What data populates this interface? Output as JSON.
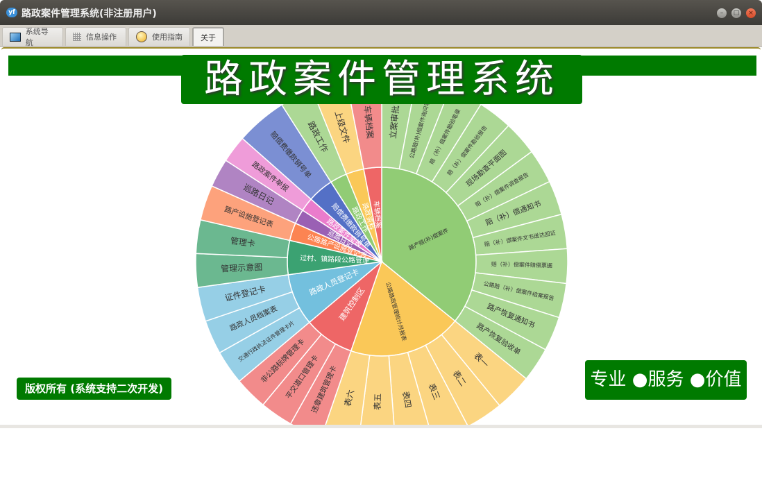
{
  "window": {
    "title": "路政案件管理系统(非注册用户)",
    "controls": [
      "minimize",
      "maximize",
      "close"
    ]
  },
  "tabs": [
    {
      "label": "系统导航",
      "icon": "monitor-icon"
    },
    {
      "label": "信息操作",
      "icon": "grid-icon"
    },
    {
      "label": "使用指南",
      "icon": "help-icon"
    },
    {
      "label": "关于",
      "active": true
    }
  ],
  "banner": {
    "title": "路政案件管理系统"
  },
  "footer": {
    "copyright": "版权所有 (系统支持二次开发)",
    "slogan": "专业 ●服务 ●价值"
  },
  "colors": {
    "brand_green": "#007a00"
  },
  "chart_data": {
    "type": "sunburst",
    "nodes": [
      {
        "name": "路产赔(补)偿案件",
        "span": [
          0,
          129
        ],
        "color": "#91cc75",
        "outer": "#acd895",
        "children": [
          "立案审批",
          "公路赔(补)偿案件询问笔录",
          "赔（补）偿案件勘验笔录",
          "赔（补）偿案件勘验报告",
          "现场勘查平面图",
          "赔（补）偿案件调查报告",
          "赔（补）偿通知书",
          "赔（补）偿案件文书送达回证",
          "赔（补）偿案件赔偿票据",
          "公路赔（补）偿案件结案报告",
          "路产恢复通知书",
          "路产恢复验收单"
        ]
      },
      {
        "name": "公路路政管理统计月报表",
        "span": [
          129,
          199
        ],
        "color": "#fac858",
        "outer": "#fbd581",
        "children": [
          "表一",
          "表二",
          "表三",
          "表四",
          "表五",
          "表六"
        ]
      },
      {
        "name": "建筑控制区",
        "span": [
          199,
          230
        ],
        "color": "#ee6666",
        "outer": "#f28b8b",
        "children": [
          "违章建筑管理卡",
          "平交道口管理卡",
          "非公路标牌管理卡"
        ]
      },
      {
        "name": "路政人员登记卡",
        "span": [
          230,
          262
        ],
        "color": "#73c0de",
        "outer": "#96cfe6",
        "children": [
          "交通行政执法证件管理卡片",
          "路政人员档案表",
          "证件登记卡"
        ]
      },
      {
        "name": "过村、镇路段公路管理",
        "span": [
          262,
          283
        ],
        "color": "#3ba272",
        "outer": "#6bb890",
        "children": [
          "管理示意图",
          "管理卡"
        ]
      },
      {
        "name": "公路路产设施登记表",
        "span": [
          283,
          294
        ],
        "color": "#fc8452",
        "outer": "#fda27c",
        "children": [
          "路产设施登记表"
        ]
      },
      {
        "name": "巡路日记",
        "span": [
          294,
          303
        ],
        "color": "#9a60b4",
        "outer": "#b084c3",
        "children": [
          "巡路日记"
        ]
      },
      {
        "name": "路政案件举报",
        "span": [
          303,
          311.5
        ],
        "color": "#ea7ccc",
        "outer": "#ef9cd9",
        "children": [
          "路政案件举报"
        ]
      },
      {
        "name": "赔偿费缴款销号单",
        "span": [
          311.5,
          327.5
        ],
        "color": "#5470c6",
        "outer": "#7b8fd3",
        "children": [
          "赔偿费缴款销号单"
        ]
      },
      {
        "name": "路政工作",
        "span": [
          327.5,
          338
        ],
        "color": "#91cc75",
        "outer": "#acd895",
        "children": [
          "路政工作"
        ]
      },
      {
        "name": "路政资料",
        "span": [
          338,
          349
        ],
        "color": "#fac858",
        "outer": "#fbd581",
        "children": [
          "上级文件"
        ]
      },
      {
        "name": "车辆档案",
        "span": [
          349,
          360
        ],
        "color": "#ee6666",
        "outer": "#f28b8b",
        "children": [
          "车辆档案"
        ]
      }
    ]
  }
}
